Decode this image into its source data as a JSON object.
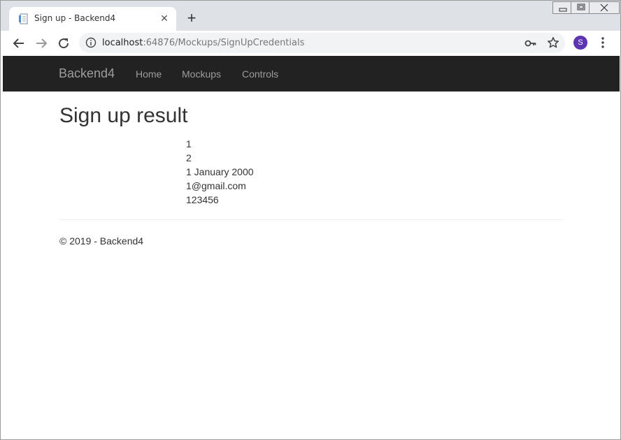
{
  "browser": {
    "tab_title": "Sign up - Backend4",
    "url_host": "localhost",
    "url_rest": ":64876/Mockups/SignUpCredentials",
    "profile_initial": "S"
  },
  "navbar": {
    "brand": "Backend4",
    "links": [
      "Home",
      "Mockups",
      "Controls"
    ]
  },
  "page": {
    "title": "Sign up result",
    "values": [
      "1",
      "2",
      "1 January 2000",
      "1@gmail.com",
      "123456"
    ],
    "footer": "© 2019 - Backend4"
  },
  "colors": {
    "navbar_bg": "#222222",
    "nav_text": "#9d9d9d",
    "avatar": "#5e35b1"
  }
}
